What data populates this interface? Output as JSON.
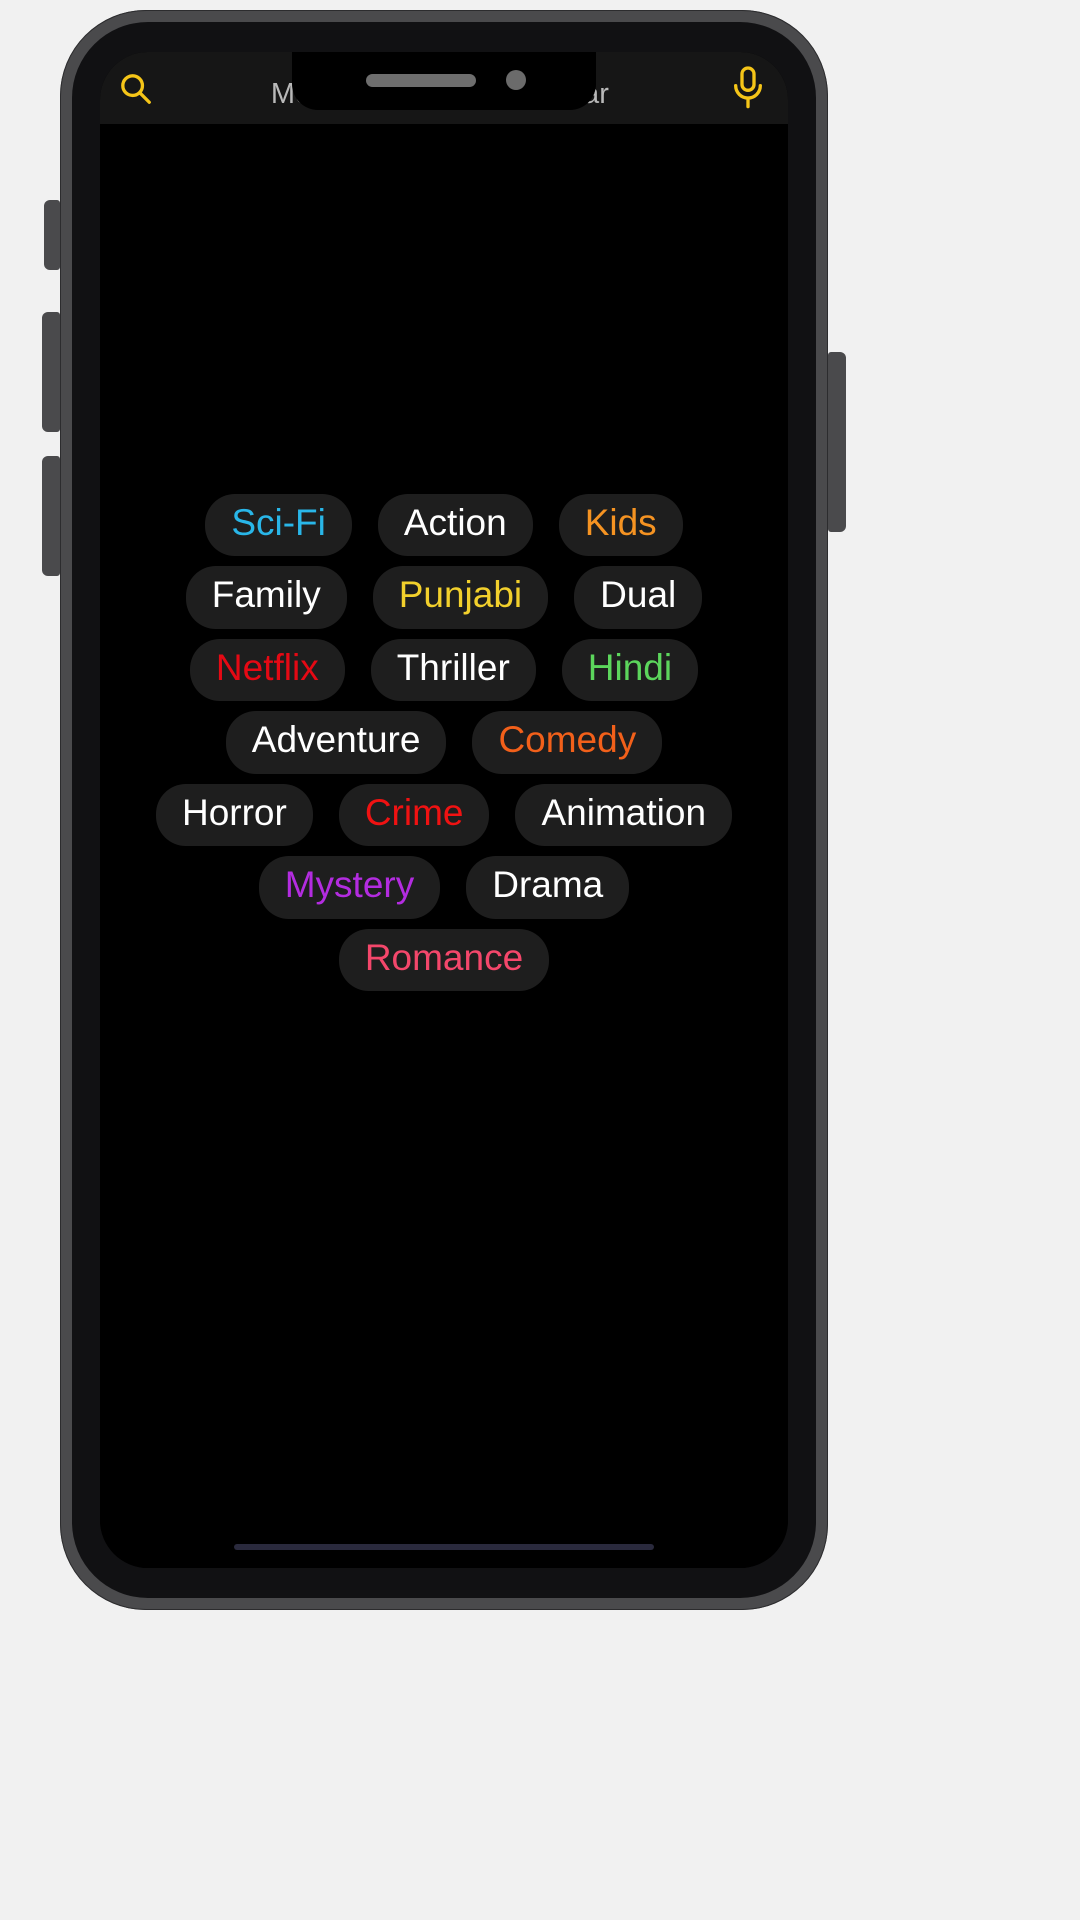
{
  "app": {
    "screen_background": "#000000",
    "chip_background": "#1e1e1e"
  },
  "search": {
    "placeholder": "Movie Name/ Genre/ Year",
    "value": "",
    "search_icon": "search-icon",
    "mic_icon": "microphone-icon",
    "icon_color": "#f5c518",
    "bar_background": "#161616",
    "placeholder_color": "#b9b9b9"
  },
  "notch": {
    "speaker": "earpiece-speaker",
    "camera": "front-camera"
  },
  "hardware": {
    "mute_switch": "mute-switch",
    "volume_up": "volume-up-button",
    "volume_down": "volume-down-button",
    "power": "power-button"
  },
  "chips": {
    "rows": [
      [
        {
          "label": "Sci-Fi",
          "color": "#29b6e8"
        },
        {
          "label": "Action",
          "color": "#ffffff"
        },
        {
          "label": "Kids",
          "color": "#f59322"
        }
      ],
      [
        {
          "label": "Family",
          "color": "#ffffff"
        },
        {
          "label": "Punjabi",
          "color": "#f2d02c"
        },
        {
          "label": "Dual",
          "color": "#ffffff"
        }
      ],
      [
        {
          "label": "Netflix",
          "color": "#e50914"
        },
        {
          "label": "Thriller",
          "color": "#ffffff"
        },
        {
          "label": "Hindi",
          "color": "#5cd65c"
        }
      ],
      [
        {
          "label": "Adventure",
          "color": "#ffffff"
        },
        {
          "label": "Comedy",
          "color": "#f2601a"
        }
      ],
      [
        {
          "label": "Horror",
          "color": "#ffffff"
        },
        {
          "label": "Crime",
          "color": "#f01212"
        },
        {
          "label": "Animation",
          "color": "#ffffff"
        }
      ],
      [
        {
          "label": "Mystery",
          "color": "#b32ce0"
        },
        {
          "label": "Drama",
          "color": "#ffffff"
        }
      ],
      [
        {
          "label": "Romance",
          "color": "#f4476b"
        }
      ]
    ]
  },
  "system": {
    "home_indicator": "home-indicator"
  }
}
